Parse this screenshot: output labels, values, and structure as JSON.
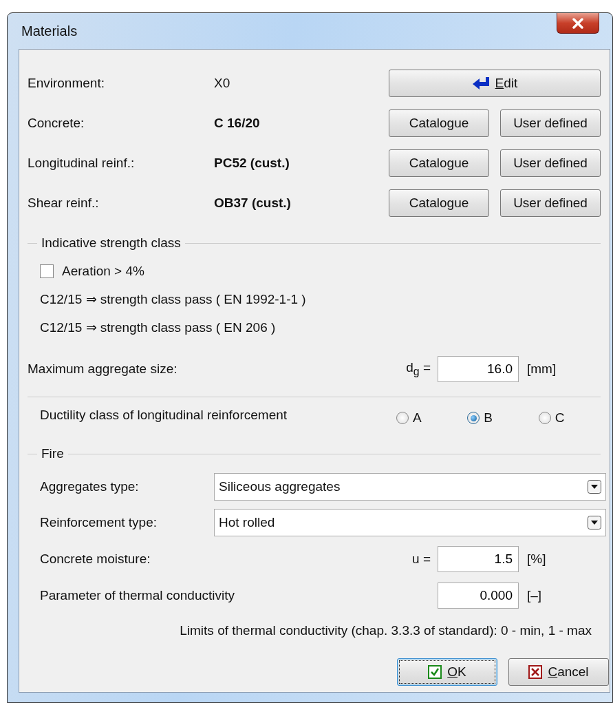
{
  "window": {
    "title": "Materials"
  },
  "materials": [
    {
      "label": "Environment:",
      "value": "X0",
      "emphasized": false,
      "buttons": [
        {
          "label": "Edit",
          "kind": "edit"
        }
      ]
    },
    {
      "label": "Concrete:",
      "value": "C 16/20",
      "emphasized": true,
      "buttons": [
        {
          "label": "Catalogue",
          "kind": "plain"
        },
        {
          "label": "User defined",
          "kind": "plain"
        }
      ]
    },
    {
      "label": "Longitudinal reinf.:",
      "value": "PC52 (cust.)",
      "emphasized": true,
      "buttons": [
        {
          "label": "Catalogue",
          "kind": "plain"
        },
        {
          "label": "User defined",
          "kind": "plain"
        }
      ]
    },
    {
      "label": "Shear reinf.:",
      "value": "OB37 (cust.)",
      "emphasized": true,
      "buttons": [
        {
          "label": "Catalogue",
          "kind": "plain"
        },
        {
          "label": "User defined",
          "kind": "plain"
        }
      ]
    }
  ],
  "strength_group": {
    "title": "Indicative strength class",
    "aeration": {
      "label": "Aeration > 4%",
      "checked": false
    },
    "results": [
      "C12/15 ⇒ strength class pass ( EN 1992-1-1 )",
      "C12/15 ⇒ strength class pass ( EN 206 )"
    ]
  },
  "aggregate": {
    "label": "Maximum aggregate size:",
    "symbol": "d$_{g}$ =",
    "value": "16.0",
    "unit": "[mm]"
  },
  "ductility": {
    "label": "Ductility class of longitudinal reinforcement",
    "options": [
      {
        "label": "A",
        "selected": false
      },
      {
        "label": "B",
        "selected": true
      },
      {
        "label": "C",
        "selected": false
      }
    ]
  },
  "fire": {
    "title": "Fire",
    "selects": [
      {
        "label": "Aggregates type:",
        "value": "Siliceous aggregates"
      },
      {
        "label": "Reinforcement type:",
        "value": "Hot rolled"
      }
    ],
    "inputs": [
      {
        "label": "Concrete moisture:",
        "symbol": "u =",
        "value": "1.5",
        "unit": "[%]"
      },
      {
        "label": "Parameter of thermal conductivity",
        "value": "0.000",
        "unit": "[–]"
      }
    ],
    "note": "Limits of thermal conductivity (chap. 3.3.3 of standard): 0 - min, 1 - max"
  },
  "buttons": [
    {
      "label": "OK",
      "kind": "ok",
      "focused": true
    },
    {
      "label": "Cancel",
      "kind": "cancel",
      "focused": false
    }
  ]
}
